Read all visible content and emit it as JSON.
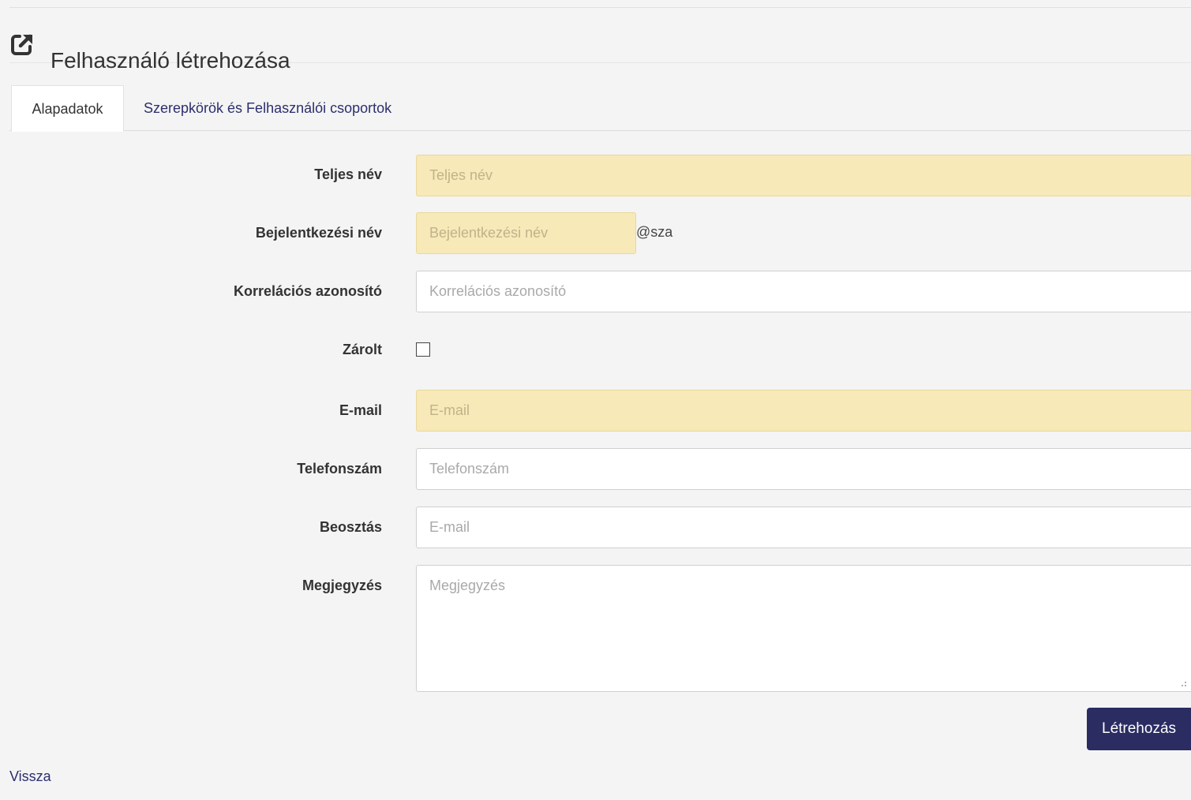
{
  "header": {
    "title": "Felhasználó létrehozása",
    "icon": "external-link-icon"
  },
  "tabs": [
    {
      "label": "Alapadatok",
      "active": true
    },
    {
      "label": "Szerepkörök és Felhasználói csoportok",
      "active": false
    }
  ],
  "form": {
    "full_name": {
      "label": "Teljes név",
      "placeholder": "Teljes név",
      "value": ""
    },
    "login_name": {
      "label": "Bejelentkezési név",
      "placeholder": "Bejelentkezési név",
      "value": "",
      "suffix": "@sza"
    },
    "correlation_id": {
      "label": "Korrelációs azonosító",
      "placeholder": "Korrelációs azonosító",
      "value": ""
    },
    "locked": {
      "label": "Zárolt",
      "checked": false
    },
    "email": {
      "label": "E-mail",
      "placeholder": "E-mail",
      "value": ""
    },
    "phone": {
      "label": "Telefonszám",
      "placeholder": "Telefonszám",
      "value": ""
    },
    "position": {
      "label": "Beosztás",
      "placeholder": "E-mail",
      "value": ""
    },
    "note": {
      "label": "Megjegyzés",
      "placeholder": "Megjegyzés",
      "value": ""
    }
  },
  "actions": {
    "submit_label": "Létrehozás",
    "back_label": "Vissza"
  },
  "colors": {
    "accent": "#2a2c62",
    "required_field_bg": "#f7e9b8",
    "link": "#2c2f6e"
  }
}
